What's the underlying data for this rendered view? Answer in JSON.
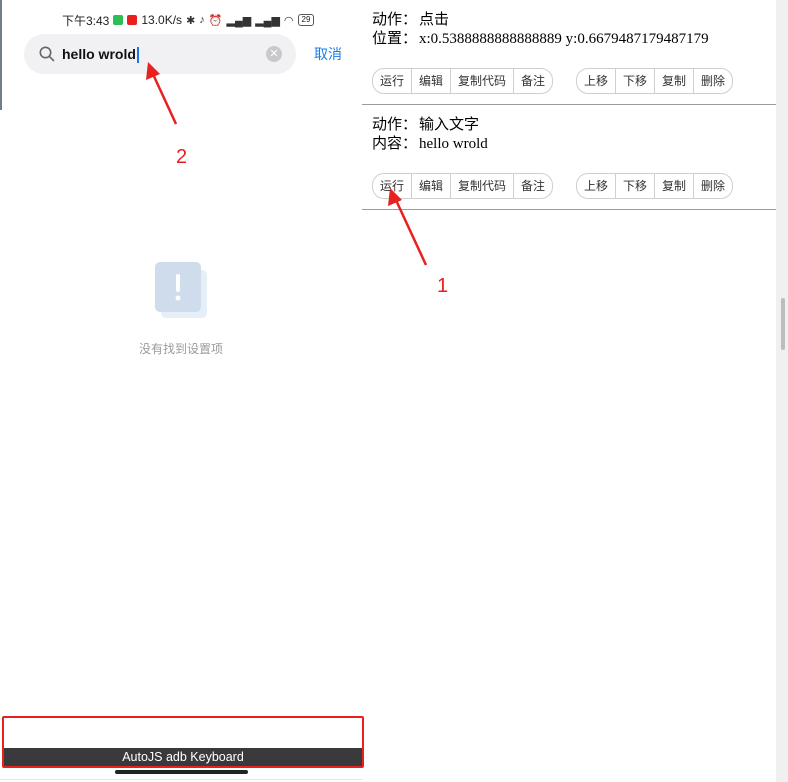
{
  "status_bar": {
    "time": "下午3:43",
    "net_speed": "13.0K/s",
    "battery": "29"
  },
  "search": {
    "query": "hello wrold",
    "cancel_label": "取消"
  },
  "empty_state": {
    "message": "没有找到设置项"
  },
  "keyboard": {
    "label": "AutoJS adb Keyboard"
  },
  "annotations": {
    "one": "1",
    "two": "2"
  },
  "actions": [
    {
      "action_label": "动作：",
      "action_value": "点击",
      "detail_label": "位置：",
      "detail_value": "x:0.5388888888888889  y:0.6679487179487179",
      "buttons_left": [
        "运行",
        "编辑",
        "复制代码",
        "备注"
      ],
      "buttons_right": [
        "上移",
        "下移",
        "复制",
        "删除"
      ]
    },
    {
      "action_label": "动作：",
      "action_value": "输入文字",
      "detail_label": "内容：",
      "detail_value": "hello wrold",
      "buttons_left": [
        "运行",
        "编辑",
        "复制代码",
        "备注"
      ],
      "buttons_right": [
        "上移",
        "下移",
        "复制",
        "删除"
      ]
    }
  ],
  "colors": {
    "accent": "#1a7ee8",
    "annotation": "#e8201e",
    "keyboard_bar": "#3a3a3c"
  }
}
